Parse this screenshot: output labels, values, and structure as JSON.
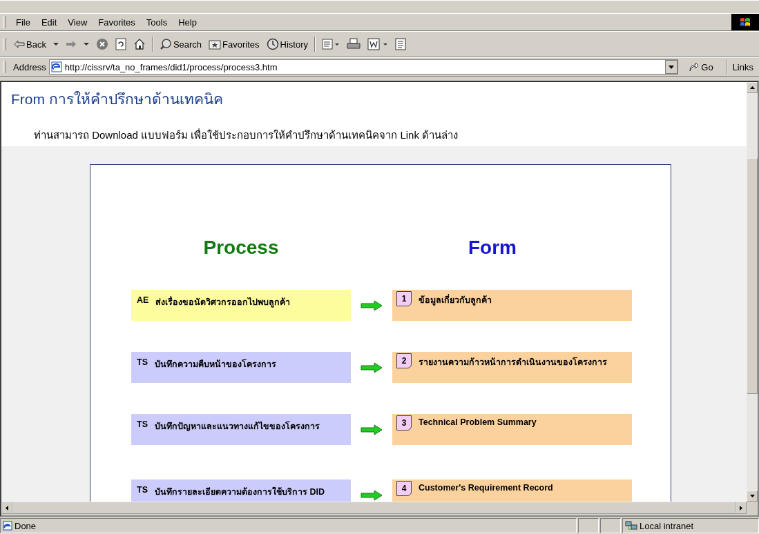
{
  "menu": [
    "File",
    "Edit",
    "View",
    "Favorites",
    "Tools",
    "Help"
  ],
  "toolbar": [
    {
      "kind": "back",
      "label": "Back"
    },
    {
      "kind": "forward"
    },
    {
      "kind": "stop"
    },
    {
      "kind": "refresh"
    },
    {
      "kind": "home"
    },
    {
      "kind": "sep"
    },
    {
      "kind": "search",
      "label": "Search"
    },
    {
      "kind": "favorites",
      "label": "Favorites"
    },
    {
      "kind": "history",
      "label": "History"
    },
    {
      "kind": "sep"
    },
    {
      "kind": "mail"
    },
    {
      "kind": "print"
    },
    {
      "kind": "edit"
    },
    {
      "kind": "discuss"
    }
  ],
  "address": {
    "label": "Address",
    "url": "http://cissrv/ta_no_frames/did1/process/process3.htm",
    "go": "Go",
    "links": "Links"
  },
  "page": {
    "title": "From การให้คำปรึกษาด้านเทคนิค",
    "intro": "ท่านสามารถ Download แบบฟอร์ม เพื่อใช้ประกอบการให้คำปรึกษาด้านเทคนิคจาก Link ด้านล่าง",
    "process_heading": "Process",
    "form_heading": "Form",
    "rows": [
      {
        "role": "AE",
        "process": "ส่งเรื่องขอนัดวิศวกรออกไปพบลูกค้า",
        "color": "#fdfd9e",
        "number": "1",
        "form": "ข้อมูลเกี่ยวกับลูกค้า"
      },
      {
        "role": "TS",
        "process": "บันทึกความคืบหน้าของโครงการ",
        "color": "#ccccfc",
        "number": "2",
        "form": "รายงานความก้าวหน้าการดำเนินงานของโครงการ"
      },
      {
        "role": "TS",
        "process": "บันทึกปัญหาและแนวทางแก้ไขของโครงการ",
        "color": "#ccccfc",
        "number": "3",
        "form": "Technical  Problem  Summary"
      },
      {
        "role": "TS",
        "process": "บันทึกรายละเอียดความต้องการใช้บริการ DID",
        "color": "#ccccfc",
        "number": "4",
        "form": "Customer's  Requirement  Record"
      }
    ]
  },
  "status_bar": {
    "text": "Done",
    "zone": "Local intranet"
  }
}
